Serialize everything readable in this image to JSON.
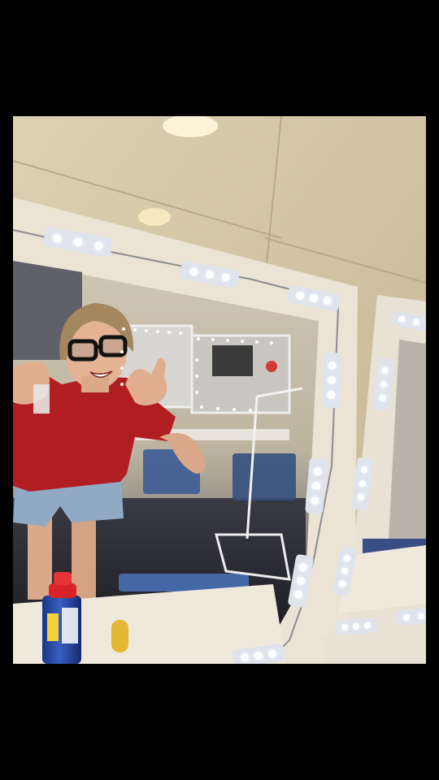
{
  "photo": {
    "description_visible_text": [],
    "colors": {
      "letterbox": "#000000",
      "wall_tile": "#d6c9aa",
      "mirror_frame": "#ece6d8",
      "led": "#ffffff",
      "shirt": "#b01e22",
      "shorts": "#8fa8c4",
      "chair": "#3e5c96",
      "can_blue": "#1f3f9a",
      "can_cap": "#d8232a"
    }
  }
}
